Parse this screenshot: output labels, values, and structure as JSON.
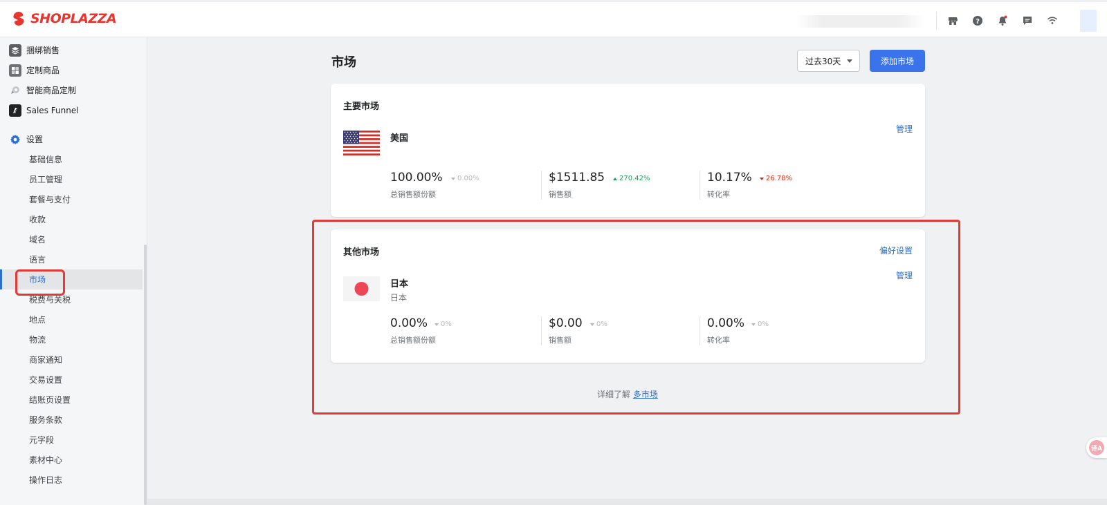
{
  "brand": {
    "name": "SHOPLAZZA",
    "color": "#e8352f"
  },
  "topbar": {
    "icons": [
      "store-icon",
      "help-icon",
      "bell-icon",
      "message-icon",
      "wifi-icon"
    ]
  },
  "sidebar": {
    "apps": [
      {
        "label": "捆绑销售",
        "icon": "bundle-icon"
      },
      {
        "label": "定制商品",
        "icon": "custom-product-icon"
      },
      {
        "label": "智能商品定制",
        "icon": "smart-custom-icon"
      },
      {
        "label": "Sales Funnel",
        "icon": "funnel-icon"
      }
    ],
    "settings_label": "设置",
    "settings_items": [
      {
        "label": "基础信息"
      },
      {
        "label": "员工管理"
      },
      {
        "label": "套餐与支付"
      },
      {
        "label": "收款"
      },
      {
        "label": "域名"
      },
      {
        "label": "语言"
      },
      {
        "label": "市场",
        "active": true
      },
      {
        "label": "税费与关税"
      },
      {
        "label": "地点"
      },
      {
        "label": "物流"
      },
      {
        "label": "商家通知"
      },
      {
        "label": "交易设置"
      },
      {
        "label": "结账页设置"
      },
      {
        "label": "服务条款"
      },
      {
        "label": "元字段"
      },
      {
        "label": "素材中心"
      },
      {
        "label": "操作日志"
      }
    ]
  },
  "page": {
    "title": "市场",
    "period": "过去30天",
    "add_button": "添加市场"
  },
  "primary_market": {
    "section_title": "主要市场",
    "manage_link": "管理",
    "name": "美国",
    "flag": "us-flag",
    "stats": [
      {
        "value": "100.00%",
        "change": "0.00%",
        "trend": "down",
        "trend_color": "#b5b8bb",
        "label": "总销售额份额"
      },
      {
        "value": "$1511.85",
        "change": "270.42%",
        "trend": "up",
        "trend_color": "#1f9d55",
        "label": "销售额"
      },
      {
        "value": "10.17%",
        "change": "26.78%",
        "trend": "down",
        "trend_color": "#d82c0d",
        "label": "转化率"
      }
    ]
  },
  "other_markets": {
    "section_title": "其他市场",
    "preferences_link": "偏好设置",
    "manage_link": "管理",
    "name": "日本",
    "subtitle": "日本",
    "flag": "japan-flag",
    "stats": [
      {
        "value": "0.00%",
        "change": "0%",
        "trend": "down",
        "trend_color": "#b5b8bb",
        "label": "总销售额份额"
      },
      {
        "value": "$0.00",
        "change": "0%",
        "trend": "down",
        "trend_color": "#b5b8bb",
        "label": "销售额"
      },
      {
        "value": "0.00%",
        "change": "0%",
        "trend": "down",
        "trend_color": "#b5b8bb",
        "label": "转化率"
      }
    ]
  },
  "footer": {
    "text": "详细了解",
    "link": "多市场"
  },
  "translate_badge": "译A"
}
